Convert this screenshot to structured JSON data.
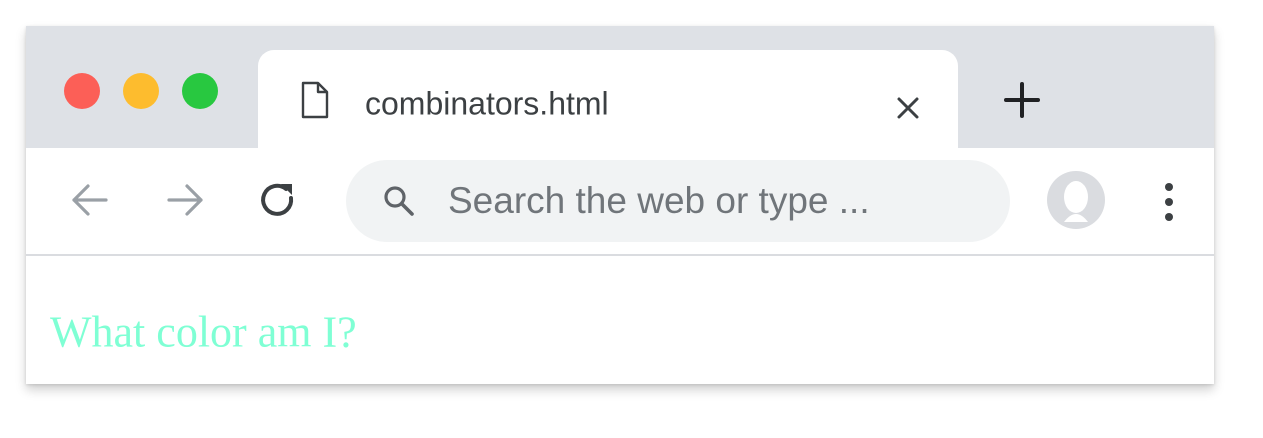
{
  "tab": {
    "title": "combinators.html",
    "icon": "document-icon",
    "close_icon": "close-icon"
  },
  "new_tab_icon": "plus-icon",
  "toolbar": {
    "back_icon": "arrow-left-icon",
    "forward_icon": "arrow-right-icon",
    "reload_icon": "reload-icon",
    "omnibox": {
      "icon": "search-icon",
      "placeholder": "Search the web or type ..."
    },
    "avatar_icon": "avatar-icon",
    "menu_icon": "kebab-menu-icon"
  },
  "page": {
    "text": "What color am I?",
    "text_color": "#7fffd4"
  },
  "colors": {
    "traffic_close": "#fc5f57",
    "traffic_minimize": "#fdbc2e",
    "traffic_maximize": "#28c840",
    "tabstrip_bg": "#dee1e6",
    "omnibox_bg": "#f1f3f4"
  }
}
